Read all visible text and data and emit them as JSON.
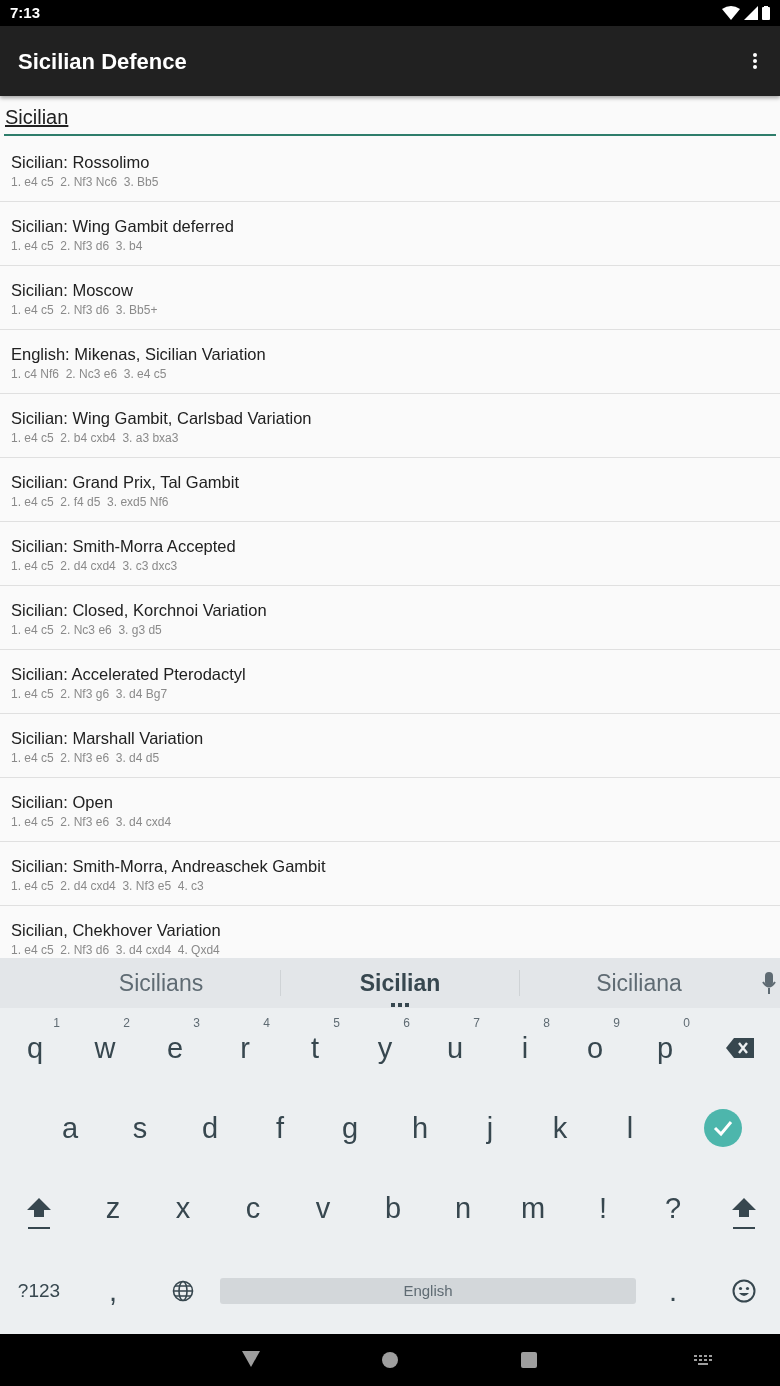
{
  "status_bar": {
    "time": "7:13"
  },
  "app_bar": {
    "title": "Sicilian Defence"
  },
  "search": {
    "value": "Sicilian"
  },
  "openings": [
    {
      "name": "Sicilian: Rossolimo",
      "moves": "1. e4 c5  2. Nf3 Nc6  3. Bb5"
    },
    {
      "name": "Sicilian: Wing Gambit deferred",
      "moves": "1. e4 c5  2. Nf3 d6  3. b4"
    },
    {
      "name": "Sicilian: Moscow",
      "moves": "1. e4 c5  2. Nf3 d6  3. Bb5+"
    },
    {
      "name": "English: Mikenas, Sicilian Variation",
      "moves": "1. c4 Nf6  2. Nc3 e6  3. e4 c5"
    },
    {
      "name": "Sicilian: Wing Gambit, Carlsbad Variation",
      "moves": "1. e4 c5  2. b4 cxb4  3. a3 bxa3"
    },
    {
      "name": "Sicilian: Grand Prix, Tal Gambit",
      "moves": "1. e4 c5  2. f4 d5  3. exd5 Nf6"
    },
    {
      "name": "Sicilian: Smith-Morra Accepted",
      "moves": "1. e4 c5  2. d4 cxd4  3. c3 dxc3"
    },
    {
      "name": "Sicilian: Closed, Korchnoi Variation",
      "moves": "1. e4 c5  2. Nc3 e6  3. g3 d5"
    },
    {
      "name": "Sicilian: Accelerated Pterodactyl",
      "moves": "1. e4 c5  2. Nf3 g6  3. d4 Bg7"
    },
    {
      "name": "Sicilian: Marshall Variation",
      "moves": "1. e4 c5  2. Nf3 e6  3. d4 d5"
    },
    {
      "name": "Sicilian: Open",
      "moves": "1. e4 c5  2. Nf3 e6  3. d4 cxd4"
    },
    {
      "name": "Sicilian: Smith-Morra, Andreaschek Gambit",
      "moves": "1. e4 c5  2. d4 cxd4  3. Nf3 e5  4. c3"
    },
    {
      "name": "Sicilian, Chekhover Variation",
      "moves": "1. e4 c5  2. Nf3 d6  3. d4 cxd4  4. Qxd4"
    }
  ],
  "keyboard": {
    "suggestions": [
      {
        "text": "Sicilians",
        "selected": false
      },
      {
        "text": "Sicilian",
        "selected": true
      },
      {
        "text": "Siciliana",
        "selected": false
      }
    ],
    "rows": [
      {
        "keys": [
          {
            "kind": "char",
            "label": "q",
            "hint": "1"
          },
          {
            "kind": "char",
            "label": "w",
            "hint": "2"
          },
          {
            "kind": "char",
            "label": "e",
            "hint": "3"
          },
          {
            "kind": "char",
            "label": "r",
            "hint": "4"
          },
          {
            "kind": "char",
            "label": "t",
            "hint": "5"
          },
          {
            "kind": "char",
            "label": "y",
            "hint": "6"
          },
          {
            "kind": "char",
            "label": "u",
            "hint": "7"
          },
          {
            "kind": "char",
            "label": "i",
            "hint": "8"
          },
          {
            "kind": "char",
            "label": "o",
            "hint": "9"
          },
          {
            "kind": "char",
            "label": "p",
            "hint": "0"
          },
          {
            "kind": "backspace"
          }
        ]
      },
      {
        "keys": [
          {
            "kind": "char",
            "label": "a"
          },
          {
            "kind": "char",
            "label": "s"
          },
          {
            "kind": "char",
            "label": "d"
          },
          {
            "kind": "char",
            "label": "f"
          },
          {
            "kind": "char",
            "label": "g"
          },
          {
            "kind": "char",
            "label": "h"
          },
          {
            "kind": "char",
            "label": "j"
          },
          {
            "kind": "char",
            "label": "k"
          },
          {
            "kind": "char",
            "label": "l"
          },
          {
            "kind": "enter"
          }
        ]
      },
      {
        "keys": [
          {
            "kind": "shift"
          },
          {
            "kind": "char",
            "label": "z"
          },
          {
            "kind": "char",
            "label": "x"
          },
          {
            "kind": "char",
            "label": "c"
          },
          {
            "kind": "char",
            "label": "v"
          },
          {
            "kind": "char",
            "label": "b"
          },
          {
            "kind": "char",
            "label": "n"
          },
          {
            "kind": "char",
            "label": "m"
          },
          {
            "kind": "char",
            "label": "!"
          },
          {
            "kind": "char",
            "label": "?"
          },
          {
            "kind": "shift"
          }
        ]
      },
      {
        "keys": [
          {
            "kind": "symbols",
            "label": "?123"
          },
          {
            "kind": "char",
            "label": ","
          },
          {
            "kind": "globe"
          },
          {
            "kind": "space",
            "label": "English"
          },
          {
            "kind": "char",
            "label": "."
          },
          {
            "kind": "emoji"
          }
        ]
      }
    ]
  }
}
